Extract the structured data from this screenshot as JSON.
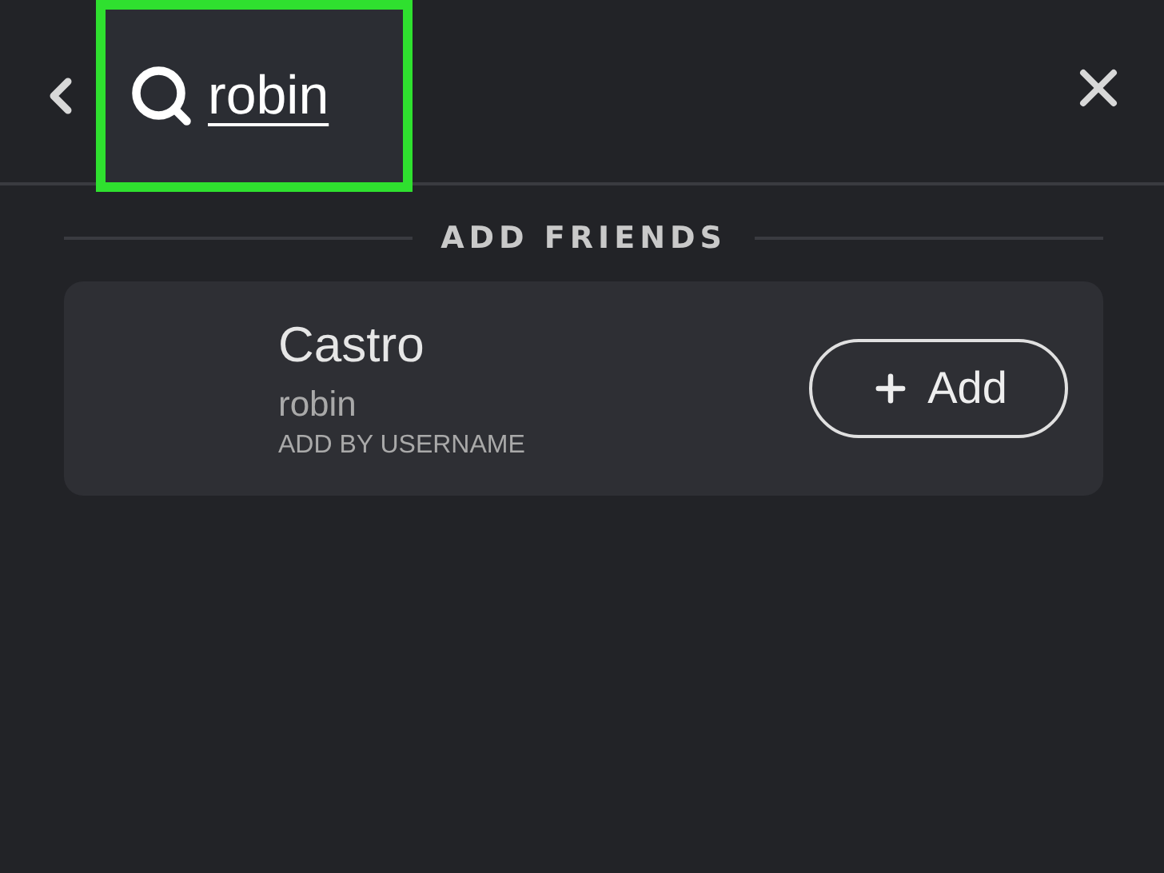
{
  "header": {
    "query": "robin",
    "highlighted": true
  },
  "section": {
    "title": "ADD FRIENDS"
  },
  "results": [
    {
      "name": "Castro",
      "username": "robin",
      "source": "ADD BY USERNAME",
      "button": "Add"
    }
  ]
}
